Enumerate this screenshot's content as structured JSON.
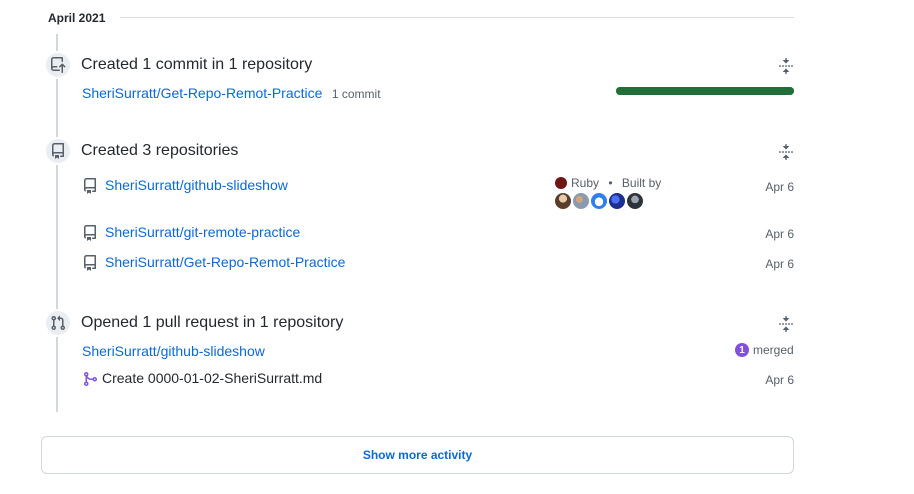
{
  "month": "April 2021",
  "commits": {
    "title": "Created 1 commit in 1 repository",
    "repo": "SheriSurratt/Get-Repo-Remot-Practice",
    "count_label": "1 commit",
    "progress": 1.0,
    "bar_color": "#216e39"
  },
  "repositories": {
    "title": "Created 3 repositories",
    "items": [
      {
        "name": "SheriSurratt/github-slideshow",
        "date": "Apr 6",
        "language": "Ruby",
        "language_color": "#701516",
        "built_by": "Built by",
        "separator": "•"
      },
      {
        "name": "SheriSurratt/git-remote-practice",
        "date": "Apr 6"
      },
      {
        "name": "SheriSurratt/Get-Repo-Remot-Practice",
        "date": "Apr 6"
      }
    ]
  },
  "pull_requests": {
    "title": "Opened 1 pull request in 1 repository",
    "repo": "SheriSurratt/github-slideshow",
    "merged_count": "1",
    "merged_label": "merged",
    "merged_color": "#8250df",
    "items": [
      {
        "title": "Create 0000-01-02-SheriSurratt.md",
        "date": "Apr 6"
      }
    ]
  },
  "show_more": "Show more activity"
}
